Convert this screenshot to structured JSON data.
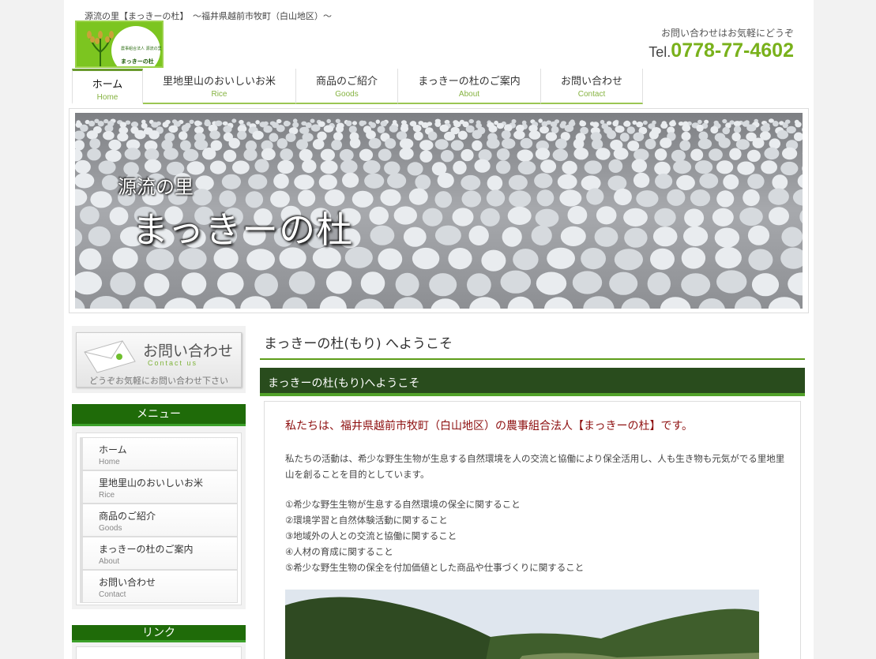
{
  "header": {
    "tagline": "源流の里【まっきーの杜】　～福井県越前市牧町（白山地区）～",
    "logo_text_small": "農事組合法人 源流の里",
    "logo_name": "まっきーの杜",
    "contact_note": "お問い合わせはお気軽にどうぞ",
    "tel_prefix": "Tel.",
    "tel_number": "0778-77-4602"
  },
  "nav": [
    {
      "ja": "ホーム",
      "en": "Home"
    },
    {
      "ja": "里地里山のおいしいお米",
      "en": "Rice"
    },
    {
      "ja": "商品のご紹介",
      "en": "Goods"
    },
    {
      "ja": "まっきーの杜のご案内",
      "en": "About"
    },
    {
      "ja": "お問い合わせ",
      "en": "Contact"
    }
  ],
  "hero": {
    "line1": "源流の里",
    "line2": "まっきーの杜"
  },
  "sidebar": {
    "contact_title": "お問い合わせ",
    "contact_sub": "Contact us",
    "contact_note": "どうぞお気軽にお問い合わせ下さい",
    "menu_heading": "メニュー",
    "menu": [
      {
        "ja": "ホーム",
        "en": "Home"
      },
      {
        "ja": "里地里山のおいしいお米",
        "en": "Rice"
      },
      {
        "ja": "商品のご紹介",
        "en": "Goods"
      },
      {
        "ja": "まっきーの杜のご案内",
        "en": "About"
      },
      {
        "ja": "お問い合わせ",
        "en": "Contact"
      }
    ],
    "links_heading": "リンク"
  },
  "main": {
    "title": "まっきーの杜(もり) へようこそ",
    "section_heading": "まっきーの杜(もり)へようこそ",
    "lead": "私たちは、福井県越前市牧町（白山地区）の農事組合法人【まっきーの杜】です。",
    "paragraph": "私たちの活動は、希少な野生生物が生息する自然環境を人の交流と協働により保全活用し、人も生き物も元気がでる里地里山を創ることを目的としています。",
    "list": [
      "①希少な野生生物が生息する自然環境の保全に関すること",
      "②環境学習と自然体験活動に関すること",
      "③地域外の人との交流と協働に関すること",
      "④人材の育成に関すること",
      "⑤希少な野生生物の保全を付加価値とした商品や仕事づくりに関すること"
    ]
  },
  "colors": {
    "accent_green": "#79b11b",
    "dark_green": "#294c1d",
    "menu_green": "#1f6b09",
    "lead_red": "#8e1010"
  }
}
